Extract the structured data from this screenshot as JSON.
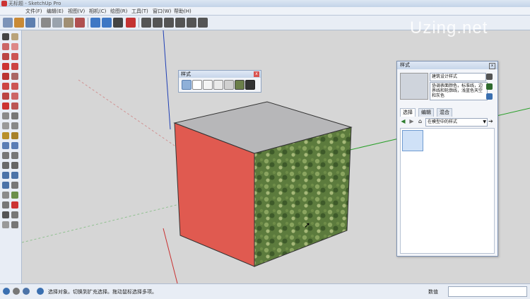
{
  "window": {
    "title": "无标题 - SketchUp Pro"
  },
  "menu": [
    "文件(F)",
    "编辑(E)",
    "视图(V)",
    "相机(C)",
    "绘图(R)",
    "工具(T)",
    "窗口(W)",
    "帮助(H)"
  ],
  "watermark": "Uzing.net",
  "styles_toolbar": {
    "title": "样式"
  },
  "styles_panel": {
    "title": "样式",
    "style_name": "建筑设计样式",
    "description": "协调表面颜色，标准线，边界线和轮廓线，浅蓝色天空和灰色",
    "tabs": [
      "选择",
      "编辑",
      "混合"
    ],
    "collection": "在模型中的样式"
  },
  "status": {
    "message": "选择对象。切换到扩充选择。拖动鼠标选择多项。",
    "measure_label": "数值",
    "measure_value": ""
  },
  "colors": {
    "face_red": "#e05a50",
    "face_top": "#b7b7b9",
    "face_camo": "#5a7a3c",
    "viewport_bg": "#d6d6d6",
    "axis_blue": "#1f3fb5",
    "axis_green": "#2aa02a",
    "axis_red": "#c93030"
  },
  "icons": [
    "select-icon",
    "paint-bucket-icon",
    "eraser-icon",
    "orbit-icon",
    "zoom-icon",
    "undo-icon",
    "redo-icon",
    "home-icon",
    "cursor-icon"
  ]
}
